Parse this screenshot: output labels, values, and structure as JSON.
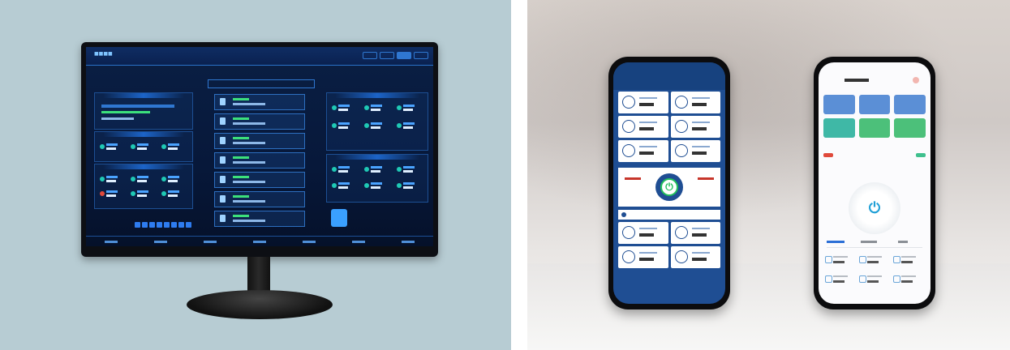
{
  "left_panel": {
    "background": "#b7ccd3",
    "monitor": {
      "brand_text": "",
      "screen_theme": "#0a1f44",
      "accent": "#2f77d1"
    }
  },
  "right_panel": {
    "phone_a": {
      "theme": "#1f4e93",
      "power_color": "#22c15a"
    },
    "phone_b": {
      "theme": "#fbfbfd",
      "power_color": "#1f9fd6",
      "card_colors": [
        "#5b8fd6",
        "#5b8fd6",
        "#5b8fd6",
        "#3fb8a6",
        "#4cc07a",
        "#4cc07a"
      ]
    }
  },
  "icons": [
    "power-icon",
    "pump-icon",
    "tank-icon",
    "gauge-icon"
  ]
}
